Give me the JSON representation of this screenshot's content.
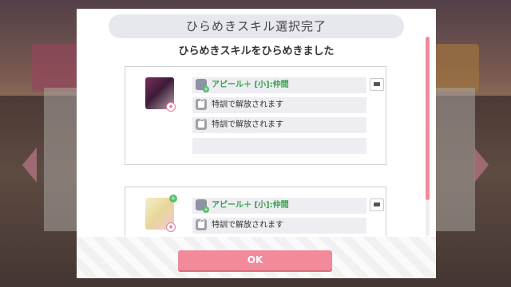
{
  "dialog": {
    "title": "ひらめきスキル選択完了",
    "subtitle": "ひらめきスキルをひらめきました"
  },
  "cards": [
    {
      "skills": [
        {
          "label": "アピール＋ [小]:仲間",
          "highlight": true
        },
        {
          "label": "特訓で解放されます",
          "highlight": false
        },
        {
          "label": "特訓で解放されます",
          "highlight": false
        },
        {
          "label": "",
          "highlight": false
        }
      ]
    },
    {
      "skills": [
        {
          "label": "アピール＋ [小]:仲間",
          "highlight": true
        },
        {
          "label": "特訓で解放されます",
          "highlight": false
        }
      ]
    }
  ],
  "ok_button": {
    "label": "OK"
  },
  "colors": {
    "accent": "#f28a9a",
    "skill_green": "#34a24c"
  },
  "icons": [
    "skill-icon",
    "lock-icon",
    "info-icon",
    "plus-badge-icon"
  ]
}
